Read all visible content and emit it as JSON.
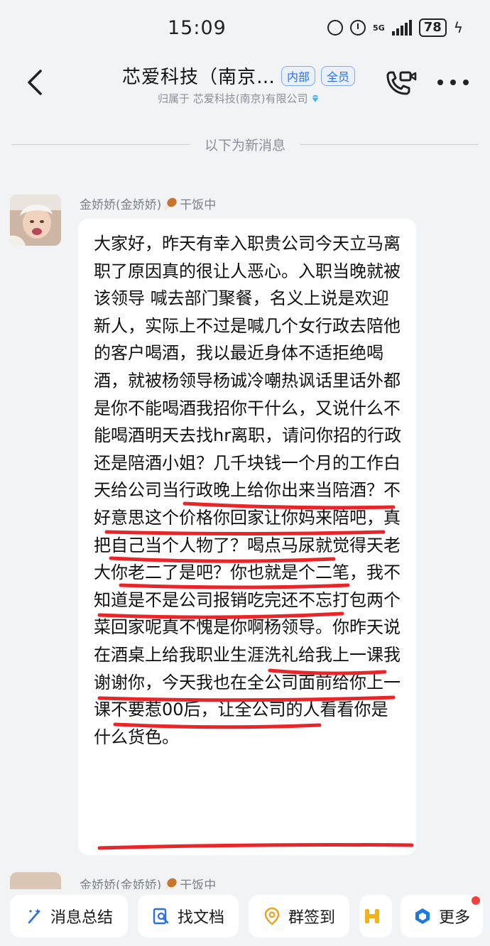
{
  "status_bar": {
    "time": "15:09",
    "network": "5G",
    "battery": "78"
  },
  "header": {
    "title": "芯爱科技（南京…",
    "tags": [
      "内部",
      "全员"
    ],
    "subtitle": "归属于 芯爱科技(南京)有限公司"
  },
  "divider": {
    "label": "以下为新消息"
  },
  "message": {
    "sender": "金娇娇(金娇娇)",
    "status": "干饭中",
    "text": "大家好，昨天有幸入职贵公司今天立马离职了原因真的很让人恶心。入职当晚就被该领导 喊去部门聚餐，名义上说是欢迎新人，实际上不过是喊几个女行政去陪他的客户喝酒，我以最近身体不适拒绝喝酒，就被杨领导杨诚冷嘲热讽话里话外都是你不能喝酒我招你干什么，又说什么不能喝酒明天去找hr离职，请问你招的行政还是陪酒小姐？几千块钱一个月的工作白天给公司当行政晚上给你出来当陪酒？不好意思这个价格你回家让你妈来陪吧，真把自己当个人物了？喝点马尿就觉得天老大你老二了是吧？你也就是个二笔，我不知道是不是公司报销吃完还不忘打包两个菜回家呢真不愧是你啊杨领导。你昨天说在酒桌上给我职业生涯洗礼给我上一课我谢谢你，今天我也在全公司面前给你上一课不要惹00后，让全公司的人看看你是什么货色。"
  },
  "next_message": {
    "sender": "金娇娇(金娇娇)",
    "status": "干饭中"
  },
  "toolbar": {
    "items": [
      {
        "label": "消息总结",
        "icon": "sparkle-icon"
      },
      {
        "label": "找文档",
        "icon": "doc-search-icon"
      },
      {
        "label": "群签到",
        "icon": "location-pin-icon"
      },
      {
        "label": "",
        "icon": "app-h-icon"
      },
      {
        "label": "更多",
        "icon": "more-apps-icon"
      }
    ]
  },
  "colors": {
    "accent": "#2a6ee8",
    "underline": "#e8262a",
    "background": "#f2f3f5"
  }
}
